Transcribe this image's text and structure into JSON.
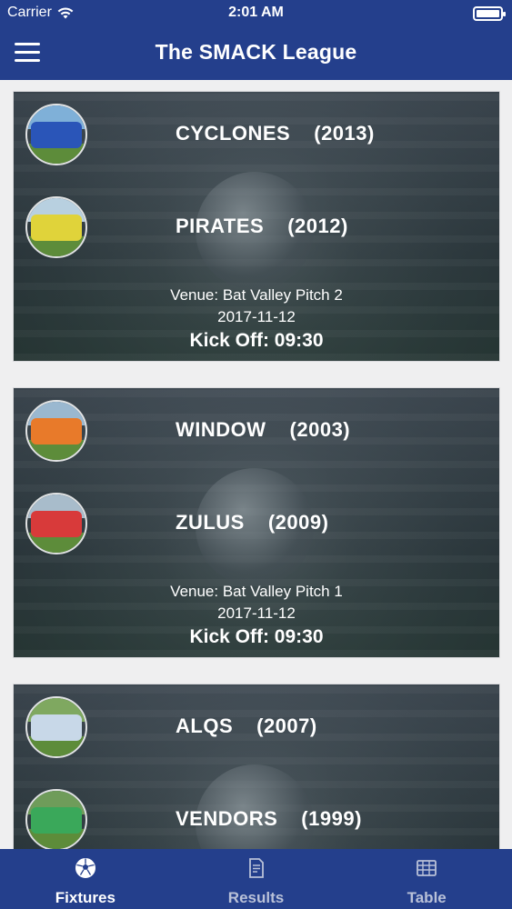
{
  "status_bar": {
    "carrier": "Carrier",
    "time": "2:01 AM"
  },
  "nav": {
    "title": "The SMACK League"
  },
  "fixtures": [
    {
      "home": {
        "name": "CYCLONES",
        "year": "(2013)",
        "kit": "#2a55b8",
        "sky": "#7fb0d8"
      },
      "away": {
        "name": "PIRATES",
        "year": "(2012)",
        "kit": "#e0d33a",
        "sky": "#b8d0e0"
      },
      "venue": "Venue: Bat Valley Pitch 2",
      "date": "2017-11-12",
      "kickoff": "Kick Off: 09:30"
    },
    {
      "home": {
        "name": "WINDOW",
        "year": "(2003)",
        "kit": "#e87a2a",
        "sky": "#9ab8d0"
      },
      "away": {
        "name": "ZULUS",
        "year": "(2009)",
        "kit": "#d83a3a",
        "sky": "#a8bccb"
      },
      "venue": "Venue: Bat Valley Pitch 1",
      "date": "2017-11-12",
      "kickoff": "Kick Off: 09:30"
    },
    {
      "home": {
        "name": "ALQS",
        "year": "(2007)",
        "kit": "#c8d8e8",
        "sky": "#7fa860"
      },
      "away": {
        "name": "VENDORS",
        "year": "(1999)",
        "kit": "#3aa85a",
        "sky": "#6f9c5a"
      },
      "venue": "",
      "date": "",
      "kickoff": ""
    }
  ],
  "tabs": [
    {
      "label": "Fixtures",
      "icon": "soccer-ball-icon",
      "active": true
    },
    {
      "label": "Results",
      "icon": "document-icon",
      "active": false
    },
    {
      "label": "Table",
      "icon": "table-icon",
      "active": false
    }
  ],
  "colors": {
    "bar": "#243f8c",
    "tab_inactive": "#b9c1d8"
  }
}
